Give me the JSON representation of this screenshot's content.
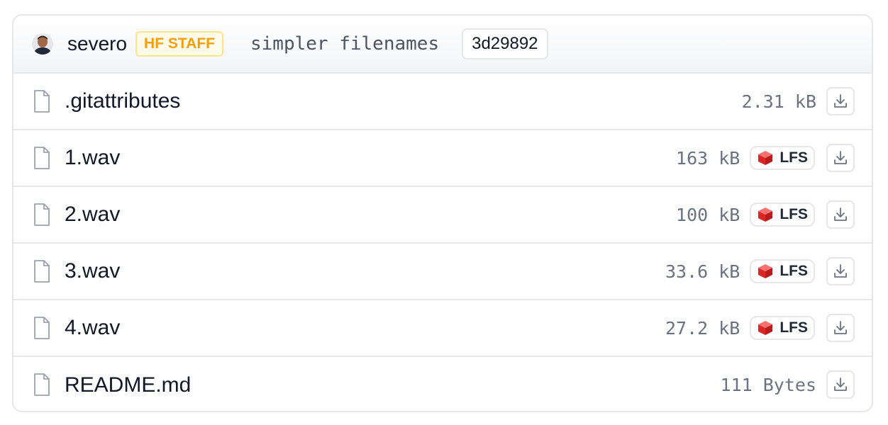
{
  "commit": {
    "author": "severo",
    "badge": "HF STAFF",
    "message": "simpler filenames",
    "hash": "3d29892"
  },
  "icons": {
    "file": "file-icon",
    "download": "download-icon",
    "lfs": "lfs-cube-icon"
  },
  "colors": {
    "staff_badge": "#f59e0b",
    "lfs_red": "#dc2626",
    "border": "#e5e7eb"
  },
  "files": [
    {
      "name": ".gitattributes",
      "size": "2.31 kB",
      "lfs": null
    },
    {
      "name": "1.wav",
      "size": "163 kB",
      "lfs": "LFS"
    },
    {
      "name": "2.wav",
      "size": "100 kB",
      "lfs": "LFS"
    },
    {
      "name": "3.wav",
      "size": "33.6 kB",
      "lfs": "LFS"
    },
    {
      "name": "4.wav",
      "size": "27.2 kB",
      "lfs": "LFS"
    },
    {
      "name": "README.md",
      "size": "111 Bytes",
      "lfs": null
    }
  ]
}
